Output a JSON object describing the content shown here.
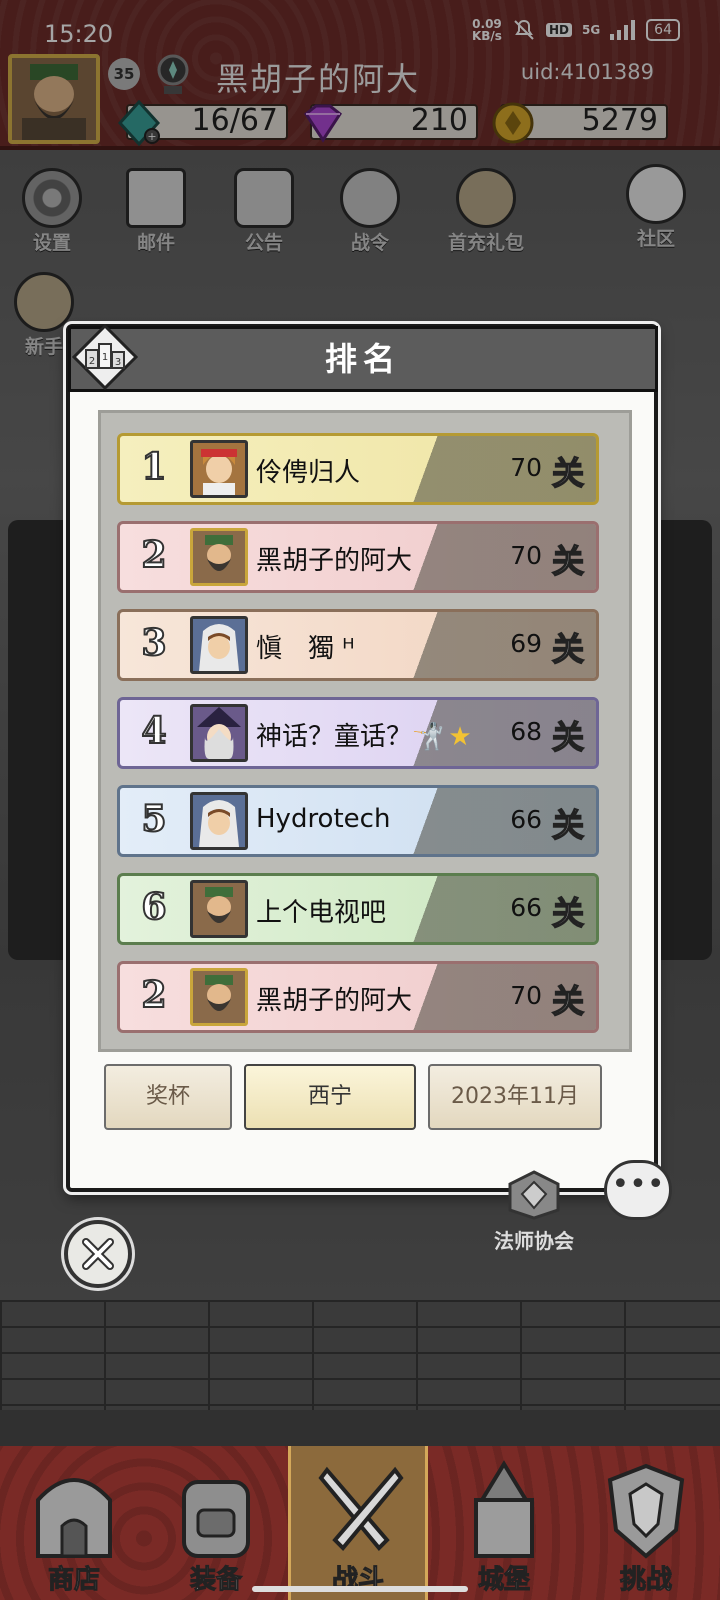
{
  "status_bar": {
    "time": "15:20",
    "net_speed_value": "0.09",
    "net_speed_unit": "KB/s",
    "hd": "HD",
    "signal": "5G",
    "battery": "64"
  },
  "profile": {
    "level": "35",
    "name": "黑胡子的阿大",
    "uid": "uid:4101389",
    "stamina": "16/67",
    "gems": "210",
    "gold": "5279"
  },
  "top_menu": [
    {
      "label": "设置",
      "icon": "gear-icon"
    },
    {
      "label": "邮件",
      "icon": "mail-icon"
    },
    {
      "label": "公告",
      "icon": "scroll-icon"
    },
    {
      "label": "战令",
      "icon": "crystal-ball-icon"
    },
    {
      "label": "首充礼包",
      "icon": "gift-bag-icon"
    },
    {
      "label": "社区",
      "icon": "home-icon"
    }
  ],
  "second_row": {
    "first_label": "新手"
  },
  "dialog": {
    "title": "排名",
    "unit": "关",
    "rows": [
      {
        "rank": "1",
        "name": "伶俜归人",
        "score": "70",
        "style": "gold"
      },
      {
        "rank": "2",
        "name": "黑胡子的阿大",
        "score": "70",
        "style": "pink"
      },
      {
        "rank": "3",
        "name": "愼　獨 ᴴ",
        "score": "69",
        "style": "peach"
      },
      {
        "rank": "4",
        "name": "神话？童话？🤺",
        "score": "68",
        "style": "violet"
      },
      {
        "rank": "5",
        "name": "Hydrotech",
        "score": "66",
        "style": "blue"
      },
      {
        "rank": "6",
        "name": "上个电视吧",
        "score": "66",
        "style": "green"
      },
      {
        "rank": "2",
        "name": "黑胡子的阿大",
        "score": "70",
        "style": "pink"
      }
    ],
    "row4_star": "★",
    "tabs": [
      "奖杯",
      "西宁",
      "2023年11月"
    ],
    "active_tab": "西宁"
  },
  "scene": {
    "mage_guild_label": "法师协会",
    "chat_symbol": "•••"
  },
  "bottom_nav": [
    {
      "label": "商店",
      "icon": "shop-icon"
    },
    {
      "label": "装备",
      "icon": "backpack-icon"
    },
    {
      "label": "战斗",
      "icon": "crossed-swords-icon"
    },
    {
      "label": "城堡",
      "icon": "castle-icon"
    },
    {
      "label": "挑战",
      "icon": "shield-icon"
    }
  ],
  "bottom_nav_active": "战斗",
  "colors": {
    "header_red": "#6f2d2a",
    "dialog_title_bg": "#5c5c5c",
    "gem_purple": "#b04bd8",
    "stamina_teal": "#3aa29a",
    "gold": "#d9a92b"
  }
}
